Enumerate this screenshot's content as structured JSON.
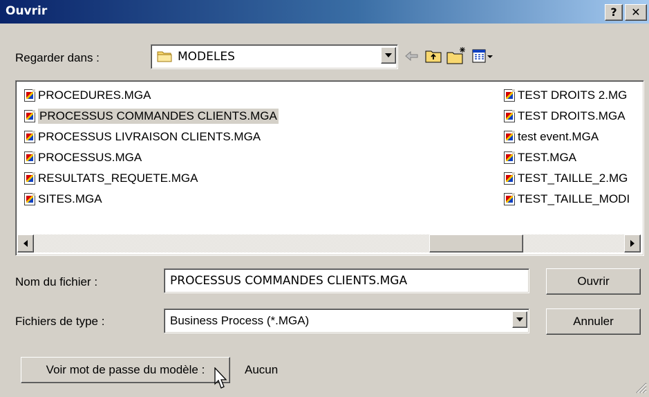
{
  "window": {
    "title": "Ouvrir",
    "help_label": "?",
    "close_label": "✕"
  },
  "look_in": {
    "label": "Regarder dans :",
    "value": "MODELES"
  },
  "toolbar": {
    "back_icon": "back-arrow-icon",
    "up_icon": "up-folder-icon",
    "new_folder_icon": "new-folder-icon",
    "view_menu_icon": "view-menu-icon"
  },
  "files": {
    "col1": [
      {
        "name": "PROCEDURES.MGA"
      },
      {
        "name": "PROCESSUS COMMANDES CLIENTS.MGA",
        "selected": true
      },
      {
        "name": "PROCESSUS LIVRAISON CLIENTS.MGA"
      },
      {
        "name": "PROCESSUS.MGA"
      },
      {
        "name": "RESULTATS_REQUETE.MGA"
      },
      {
        "name": "SITES.MGA"
      }
    ],
    "col2": [
      {
        "name": "TEST DROITS 2.MG"
      },
      {
        "name": "TEST DROITS.MGA"
      },
      {
        "name": "test event.MGA"
      },
      {
        "name": "TEST.MGA"
      },
      {
        "name": "TEST_TAILLE_2.MG"
      },
      {
        "name": "TEST_TAILLE_MODI"
      }
    ]
  },
  "filename": {
    "label": "Nom du fichier :",
    "value": "PROCESSUS COMMANDES CLIENTS.MGA"
  },
  "filetype": {
    "label": "Fichiers de type :",
    "value": "Business Process (*.MGA)"
  },
  "buttons": {
    "open": "Ouvrir",
    "cancel": "Annuler",
    "password": "Voir mot de passe du modèle :"
  },
  "password_value": "Aucun"
}
